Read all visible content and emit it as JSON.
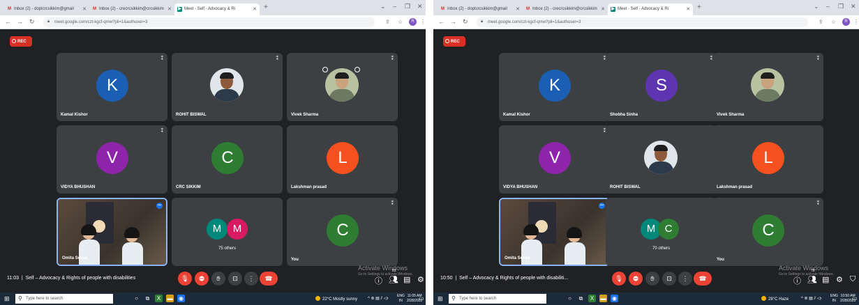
{
  "colors": {
    "meet_bg": "#202124",
    "tile_bg": "#3c4043",
    "red": "#ea4335",
    "rec": "#d93025",
    "blue_k": "#1a5fb4",
    "purple": "#8e24aa",
    "green": "#2e7d32",
    "orange": "#f4511e",
    "teal": "#00897b",
    "pink": "#d81b60",
    "taskbar": "#1c2a3a"
  },
  "left": {
    "tabs": [
      {
        "label": "Inbox (2) - doptcrcsikkim@gmail",
        "icon": "gmail-icon"
      },
      {
        "label": "Inbox (2) - crecrcsikkim@crcsikkim",
        "icon": "gmail-icon"
      },
      {
        "label": "Meet - Self - Advocacy & Ri",
        "icon": "meet-icon"
      }
    ],
    "url": "meet.google.com/czt-kgcf-qmw?pli=1&authuser=3",
    "profile_initial": "R",
    "rec_label": "REC",
    "tiles": [
      {
        "name": "Kamal Kishor",
        "initial": "K"
      },
      {
        "name": "ROHIT BISWAL"
      },
      {
        "name": "Vivek Sharma"
      },
      {
        "name": "VIDYA BHUSHAN",
        "initial": "V"
      },
      {
        "name": "CRC SIKKIM",
        "initial": "C"
      },
      {
        "name": "Lakshman prasad",
        "initial": "L"
      },
      {
        "name": "Omita Sense"
      },
      {
        "others_initials": [
          "M",
          "M"
        ],
        "others_count": "75 others"
      },
      {
        "name": "You",
        "initial": "C"
      }
    ],
    "meeting_time": "11:03",
    "meeting_title": "Self – Advocacy & Rights of people with disabilities",
    "watermark_title": "Activate Windows",
    "watermark_sub": "Go to Settings to activate Windows.",
    "people_count": "83",
    "search_placeholder": "Type here to search",
    "weather": "22°C  Mostly sunny",
    "lang_top": "ENG",
    "lang_bottom": "IN",
    "clock_time": "11:05 AM",
    "clock_date": "2/28/2022"
  },
  "right": {
    "tabs": [
      {
        "label": "Inbox (2) - doptcrcsikkim@gmail",
        "icon": "gmail-icon"
      },
      {
        "label": "Inbox (2) - crecrcsikkim@crcsikkim",
        "icon": "gmail-icon"
      },
      {
        "label": "Meet - Self - Advocacy & Ri",
        "icon": "meet-icon"
      }
    ],
    "url": "meet.google.com/czt-kgcf-qmw?pli=1&authuser=3",
    "profile_initial": "R",
    "rec_label": "REC",
    "tiles": [
      {
        "name": "Kamal Kishor",
        "initial": "K"
      },
      {
        "name": "Shobha Sinha",
        "initial": "S"
      },
      {
        "name": "Vivek Sharma"
      },
      {
        "name": "VIDYA BHUSHAN",
        "initial": "V"
      },
      {
        "name": "ROHIT BISWAL"
      },
      {
        "name": "Lakshman prasad",
        "initial": "L"
      },
      {
        "name": "Omita Sense"
      },
      {
        "others_initials": [
          "M",
          "C"
        ],
        "others_count": "70 others"
      },
      {
        "name": "You",
        "initial": "C"
      }
    ],
    "meeting_time": "10:50",
    "meeting_title": "Self – Advocacy & Rights of people with disabiliti...",
    "watermark_title": "Activate Windows",
    "watermark_sub": "Go to Settings to activate Windows.",
    "people_count": "78",
    "search_placeholder": "Type here to search",
    "weather": "28°C  Haze",
    "lang_top": "ENG",
    "lang_bottom": "IN",
    "clock_time": "10:50 AM",
    "clock_date": "2/28/2022"
  }
}
